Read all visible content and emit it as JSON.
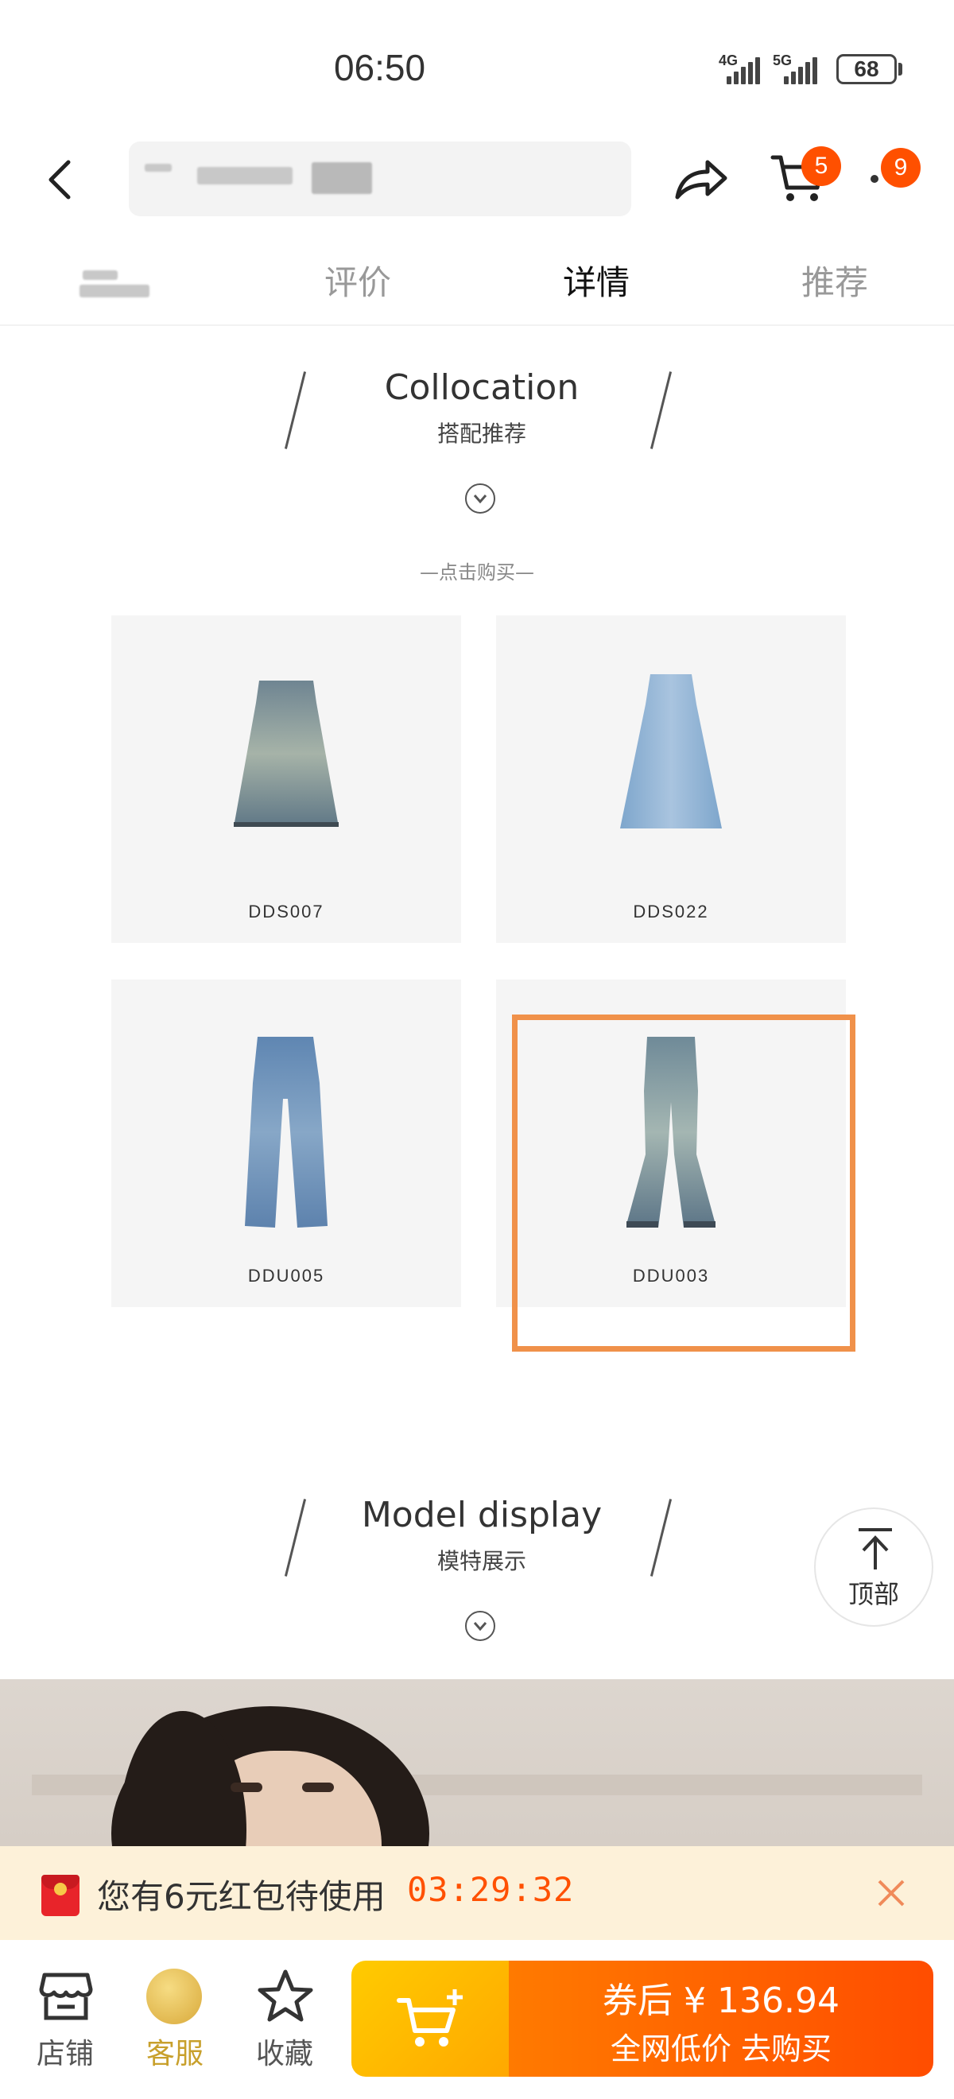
{
  "status_bar": {
    "time": "06:50",
    "net1": "4G",
    "net2": "5G",
    "battery": "68"
  },
  "header": {
    "cart_badge": "5",
    "more_badge": "9"
  },
  "tabs": [
    {
      "label": "评价"
    },
    {
      "label": "详情"
    },
    {
      "label": "推荐"
    }
  ],
  "collocation": {
    "title": "Collocation",
    "subtitle": "搭配推荐",
    "buy_hint": "—点击购买—"
  },
  "products": [
    {
      "code": "DDS007"
    },
    {
      "code": "DDS022"
    },
    {
      "code": "DDU005"
    },
    {
      "code": "DDU003"
    }
  ],
  "model_display": {
    "title": "Model display",
    "subtitle": "模特展示"
  },
  "back_to_top": {
    "label": "顶部"
  },
  "coupon": {
    "text": "您有6元红包待使用",
    "timer": "03:29:32"
  },
  "bottom_bar": {
    "shop": "店铺",
    "service": "客服",
    "favorite": "收藏",
    "buy_line1": "券后 ¥ 136.94",
    "buy_line2": "全网低价  去购买"
  },
  "colors": {
    "accent_orange": "#ff5000",
    "highlight_border": "#f0914a",
    "coupon_bg": "#fdf1d9",
    "cart_btn": "#ffb800",
    "service_gold": "#c8a02c"
  }
}
